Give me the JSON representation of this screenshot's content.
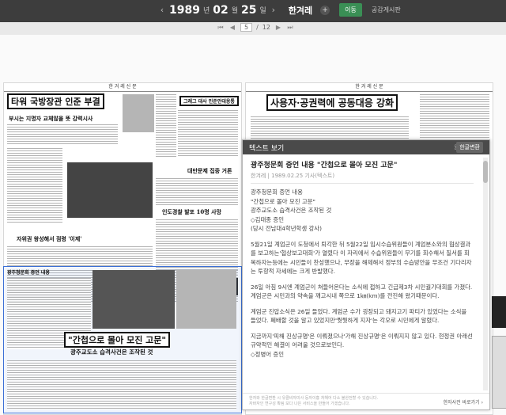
{
  "topbar": {
    "year": "1989",
    "year_unit": "년",
    "month": "02",
    "month_unit": "월",
    "day": "25",
    "day_unit": "일",
    "paper": "한겨레",
    "go_label": "이동",
    "notice_label": "공감게시판"
  },
  "pager": {
    "current": "5",
    "separator": "/",
    "total": "12"
  },
  "newspaper": {
    "left_page": {
      "masthead": "한 겨 레 신 문",
      "headline_main": "타워 국방장관 인준 부결",
      "headline_sub": "부시는 지명자 교체않을 뜻 강력시사",
      "headline_box": "그레그 대사 인준안대응통",
      "headline_hwang": "자위권 왕성해서 점령 '이제'",
      "headline_taiwan": "대만문제 집중 거론",
      "headline_police": "인도경찰 발포 10명 사망",
      "headline_gwangju": "\"간첩으로 몰아 모진 고문\"",
      "headline_gwangju_sub": "광주교도소 습격사건은 조작된 것",
      "hearing_label": "광주청문회 증언 내용"
    },
    "right_page": {
      "masthead": "한 겨 레 신 문",
      "headline_main": "사용자·공권력에 공동대응 강화"
    }
  },
  "text_panel": {
    "title": "텍스트 보기",
    "original_label": "원문",
    "korean_label": "한글변환",
    "article_title": "광주청문회 증언 내용 \"간첩으로 몰아 모진 고문\"",
    "article_meta": "한겨레 | 1989.02.25 기사(텍스트)",
    "paragraphs": [
      "광주청문회 증언 내용\n\"간첩으로 몰아 모진 고문\"\n광주교도소 습격사건은 조작된 것\n◇김태종 증인\n(당시 전남대4학년학생 강사)",
      "5월21일 계엄군이 도청에서 퇴각한 뒤 5월22일 임시수습위원들이 계엄분소와의 협상결과를 보고하는'협상보고대회'가 열렸다 이 자리에서 수습위원들이 무기를 회수해서 질서를 회복하자는등에는 시민들이 찬성했으나, 무장을 해제해서 정부의 수습방안을 무조건 기다리자는 투항적 자세에는 크게 반발했다.",
      "26일 아침 9시엔 계엄군이 쳐들어온다는 소식에 접하고 긴급제3차 시민궐기대회를 가졌다.계엄군은 시민과의 약속을 깨고시내 쪽으로 1㎞(km)를 전진해 왔기때문이다.",
      "계엄군 진압소식은 26일 들었다. 계엄군 수가 굉장되고 돼지고기 파티가 있었다는 소식을 들었다. 폐배할 것을 알고 있었지만'뭣뭣하게 지자'는 각오로 시민에게 알렸다.",
      "지금까지'피해 진상규명'은 이뤄졌으나'가해 진상규명'은 이뤄지지 않고 있다. 현정권 아래선규약적인 해결이 어려울 것으로보인다.\n◇정병어 증인"
    ],
    "footer_notice": "한자와 한글변환 시 유클비자미사 등자이흉 처해어 다소 불완전할 수 있습니다.\n자바자인 연구성 확됨 보다 나은 서비스을 만들어 가겠습니다.",
    "footer_button": "한자사전 바로가기 ›"
  }
}
